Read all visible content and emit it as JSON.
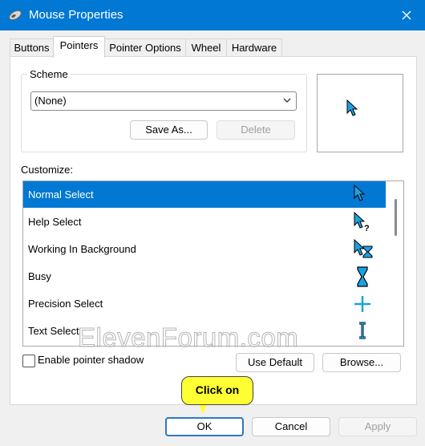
{
  "window": {
    "title": "Mouse Properties"
  },
  "tabs": [
    "Buttons",
    "Pointers",
    "Pointer Options",
    "Wheel",
    "Hardware"
  ],
  "scheme": {
    "label": "Scheme",
    "value": "(None)",
    "save_as": "Save As...",
    "delete": "Delete"
  },
  "customize": {
    "label": "Customize:",
    "items": [
      {
        "label": "Normal Select",
        "icon": "arrow-cursor-icon"
      },
      {
        "label": "Help Select",
        "icon": "help-cursor-icon"
      },
      {
        "label": "Working In Background",
        "icon": "working-cursor-icon"
      },
      {
        "label": "Busy",
        "icon": "hourglass-icon"
      },
      {
        "label": "Precision Select",
        "icon": "crosshair-icon"
      },
      {
        "label": "Text Select",
        "icon": "text-beam-icon"
      }
    ],
    "selected_index": 0
  },
  "options": {
    "shadow_label": "Enable pointer shadow",
    "shadow_checked": false,
    "use_default": "Use Default",
    "browse": "Browse..."
  },
  "callout": {
    "text": "Click on"
  },
  "footer": {
    "ok": "OK",
    "cancel": "Cancel",
    "apply": "Apply"
  },
  "watermark": "ElevenForum.com",
  "colors": {
    "accent": "#0078d4",
    "cursor": "#1ba1e2",
    "callout": "#ffff33"
  }
}
